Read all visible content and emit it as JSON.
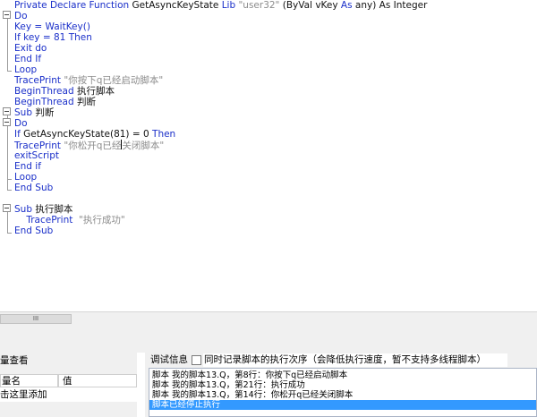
{
  "editor": {
    "lines": [
      {
        "segs": [
          {
            "t": "Private Declare Function ",
            "c": "kw"
          },
          {
            "t": "GetAsyncKeyState ",
            "c": "plain"
          },
          {
            "t": "Lib ",
            "c": "kw"
          },
          {
            "t": "\"user32\"",
            "c": "str"
          },
          {
            "t": " (ByVal vKey ",
            "c": "plain"
          },
          {
            "t": "As ",
            "c": "kw"
          },
          {
            "t": "any) ",
            "c": "plain"
          },
          {
            "t": "As Integer",
            "c": "plain"
          }
        ]
      },
      {
        "segs": [
          {
            "t": "Do",
            "c": "kw"
          }
        ]
      },
      {
        "segs": [
          {
            "t": "Key = ",
            "c": "kw"
          },
          {
            "t": "WaitKey()",
            "c": "kw"
          }
        ]
      },
      {
        "segs": [
          {
            "t": "If key = 81 ",
            "c": "kw"
          },
          {
            "t": "Then",
            "c": "kw"
          }
        ]
      },
      {
        "segs": [
          {
            "t": "Exit do",
            "c": "kw"
          }
        ]
      },
      {
        "segs": [
          {
            "t": "End If",
            "c": "kw"
          }
        ]
      },
      {
        "segs": [
          {
            "t": "Loop",
            "c": "kw"
          }
        ]
      },
      {
        "segs": [
          {
            "t": "TracePrint ",
            "c": "kw"
          },
          {
            "t": "\"你按下q已经启动脚本\"",
            "c": "str"
          }
        ]
      },
      {
        "segs": [
          {
            "t": "BeginThread ",
            "c": "kw"
          },
          {
            "t": "执行脚本",
            "c": "plain"
          }
        ]
      },
      {
        "segs": [
          {
            "t": "BeginThread ",
            "c": "kw"
          },
          {
            "t": "判断",
            "c": "plain"
          }
        ]
      },
      {
        "segs": [
          {
            "t": "Sub ",
            "c": "kw"
          },
          {
            "t": "判断",
            "c": "plain"
          }
        ]
      },
      {
        "segs": [
          {
            "t": "Do",
            "c": "kw"
          }
        ]
      },
      {
        "segs": [
          {
            "t": "If ",
            "c": "kw"
          },
          {
            "t": "GetAsyncKeyState(81) = 0 ",
            "c": "plain"
          },
          {
            "t": "Then",
            "c": "kw"
          }
        ]
      },
      {
        "segs": [
          {
            "t": "TracePrint ",
            "c": "kw"
          },
          {
            "t": "\"你松开q已经",
            "c": "str"
          },
          {
            "t": "",
            "c": "caret"
          },
          {
            "t": "关闭脚本\"",
            "c": "str"
          }
        ]
      },
      {
        "segs": [
          {
            "t": "exitScript",
            "c": "kw"
          }
        ]
      },
      {
        "segs": [
          {
            "t": "End if",
            "c": "kw"
          }
        ]
      },
      {
        "segs": [
          {
            "t": "Loop",
            "c": "kw"
          }
        ]
      },
      {
        "segs": [
          {
            "t": "End Sub",
            "c": "kw"
          }
        ]
      },
      {
        "segs": []
      },
      {
        "segs": [
          {
            "t": "Sub ",
            "c": "kw"
          },
          {
            "t": "执行脚本",
            "c": "plain"
          }
        ]
      },
      {
        "segs": [
          {
            "t": "    TracePrint ",
            "c": "kw"
          },
          {
            "t": " \"执行成功\"",
            "c": "str"
          }
        ]
      },
      {
        "segs": [
          {
            "t": "End Sub",
            "c": "kw"
          }
        ]
      }
    ]
  },
  "scrollbar": {
    "thumb_glyph": "III"
  },
  "variables": {
    "title": "量查看",
    "col_name": "量名",
    "col_value": "值",
    "add_hint": "击这里添加"
  },
  "debug": {
    "label": "调试信息",
    "checkbox_label": "同时记录脚本的执行次序（会降低执行速度，暂不支持多线程脚本）",
    "checkbox_checked": false,
    "log": [
      "脚本 我的脚本13.Q，第8行：你按下q已经启动脚本",
      "脚本 我的脚本13.Q，第21行：执行成功",
      "脚本 我的脚本13.Q，第14行：你松开q已经关闭脚本",
      "脚本已经停止执行"
    ],
    "selected_index": 3
  },
  "colors": {
    "keyword": "#1a2fc9",
    "string": "#8c8c8c",
    "selection": "#3399ff"
  }
}
